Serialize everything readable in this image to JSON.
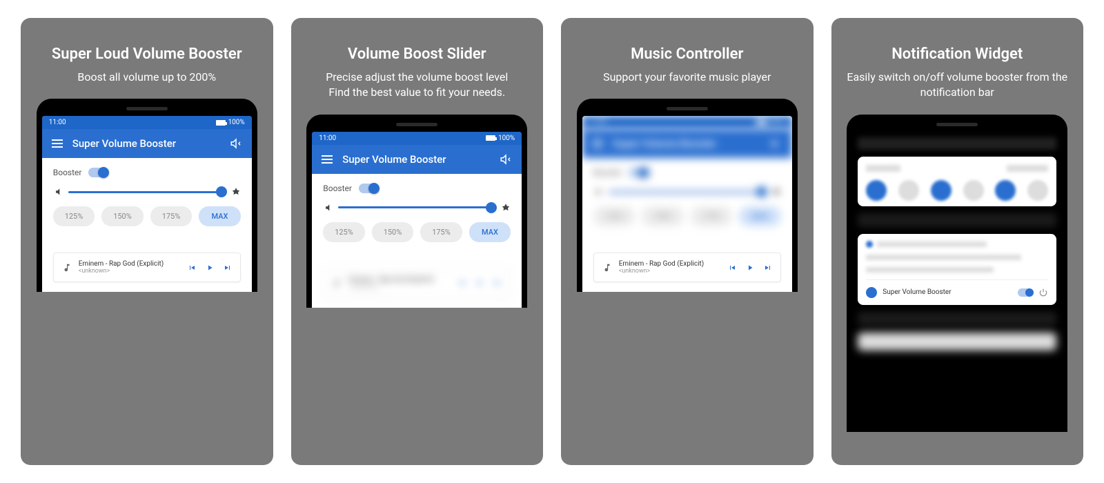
{
  "panels": [
    {
      "title": "Super Loud Volume Booster",
      "subtitle": "Boost all volume up to 200%"
    },
    {
      "title": "Volume Boost Slider",
      "subtitle": "Precise adjust the volume boost level\nFind the best value to fit your needs."
    },
    {
      "title": "Music Controller",
      "subtitle": "Support your favorite music player"
    },
    {
      "title": "Notification Widget",
      "subtitle": "Easily switch on/off volume booster from the notification bar"
    }
  ],
  "statusbar": {
    "time": "11:00",
    "battery": "100%"
  },
  "app": {
    "title": "Super Volume Booster",
    "booster_label": "Booster",
    "presets": [
      "125%",
      "150%",
      "175%",
      "MAX"
    ],
    "active_preset_index": 3
  },
  "music": {
    "track": "Eminem - Rap God (Explicit)",
    "artist": "<unknown>"
  },
  "notification": {
    "app_name": "Super Volume Booster"
  }
}
